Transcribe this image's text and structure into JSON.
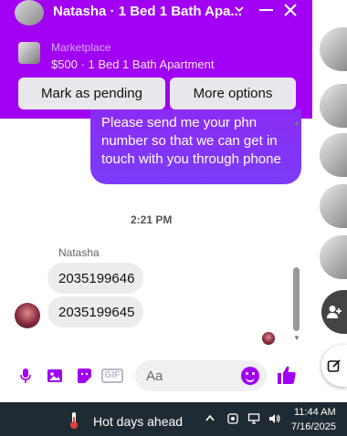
{
  "header": {
    "title": "Natasha · 1 Bed 1 Bath Apa...",
    "marketplace_label": "Marketplace",
    "listing": "$500 · 1 Bed 1 Bath Apartment",
    "mark_pending_label": "Mark as pending",
    "more_options_label": "More options"
  },
  "messages": {
    "outgoing_text": "Please send me your phn number so that we can get in touch with you through phone",
    "timestamp": "2:21 PM",
    "sender_name": "Natasha",
    "incoming": [
      "2035199646",
      "2035199645"
    ]
  },
  "composer": {
    "placeholder": "Aa",
    "gif_label": "GIF"
  },
  "taskbar": {
    "weather": "Hot days ahead",
    "time": "11:44 AM",
    "date": "7/16/2025"
  },
  "colors": {
    "accent": "#a100f2",
    "bubble_out": "#8a2cf6",
    "bubble_in": "#ececec",
    "taskbar": "#1f2b32"
  },
  "icons": [
    "minimize-icon",
    "close-icon",
    "chevron-down-icon",
    "microphone-icon",
    "image-icon",
    "sticker-icon",
    "gif-icon",
    "emoji-icon",
    "thumbs-up-icon",
    "new-message-icon",
    "add-person-icon",
    "thermometer-icon"
  ]
}
